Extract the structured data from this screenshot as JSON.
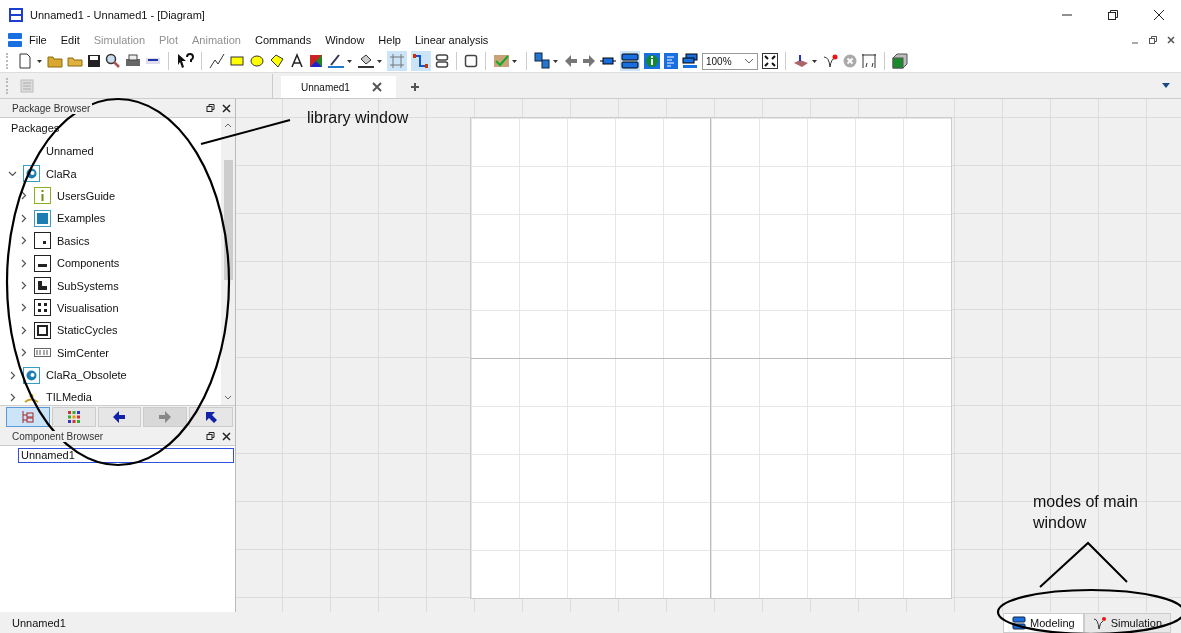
{
  "window": {
    "title": "Unnamed1 - Unnamed1  - [Diagram]"
  },
  "menu": [
    {
      "label": "File",
      "disabled": false
    },
    {
      "label": "Edit",
      "disabled": false
    },
    {
      "label": "Simulation",
      "disabled": true
    },
    {
      "label": "Plot",
      "disabled": true
    },
    {
      "label": "Animation",
      "disabled": true
    },
    {
      "label": "Commands",
      "disabled": false
    },
    {
      "label": "Window",
      "disabled": false
    },
    {
      "label": "Help",
      "disabled": false
    },
    {
      "label": "Linear analysis",
      "disabled": false
    }
  ],
  "toolbar": {
    "zoom": "100%"
  },
  "tabs": [
    {
      "label": "Unnamed1",
      "selected": true
    }
  ],
  "package_browser": {
    "title": "Package Browser",
    "heading": "Packages",
    "items": [
      {
        "label": "Unnamed",
        "kind": "plain"
      },
      {
        "label": "ClaRa",
        "kind": "library",
        "expanded": true,
        "children": [
          {
            "label": "UsersGuide",
            "kind": "info",
            "expanded": false
          },
          {
            "label": "Examples",
            "kind": "examples",
            "expanded": false
          },
          {
            "label": "Basics",
            "kind": "basics",
            "expanded": false
          },
          {
            "label": "Components",
            "kind": "components",
            "expanded": false
          },
          {
            "label": "SubSystems",
            "kind": "subsystems",
            "expanded": false
          },
          {
            "label": "Visualisation",
            "kind": "visualisation",
            "expanded": false
          },
          {
            "label": "StaticCycles",
            "kind": "static",
            "expanded": false
          },
          {
            "label": "SimCenter",
            "kind": "simcenter",
            "expanded": false
          }
        ]
      },
      {
        "label": "ClaRa_Obsolete",
        "kind": "library",
        "expanded": false
      },
      {
        "label": "TILMedia",
        "kind": "media",
        "expanded": false
      }
    ]
  },
  "component_browser": {
    "title": "Component Browser",
    "value": "Unnamed1"
  },
  "status_bar": {
    "text": "Unnamed1",
    "modes": [
      {
        "label": "Modeling",
        "selected": true
      },
      {
        "label": "Simulation",
        "selected": false
      }
    ]
  },
  "annotations": [
    {
      "text": "library window"
    },
    {
      "text": "modes of main window"
    }
  ]
}
